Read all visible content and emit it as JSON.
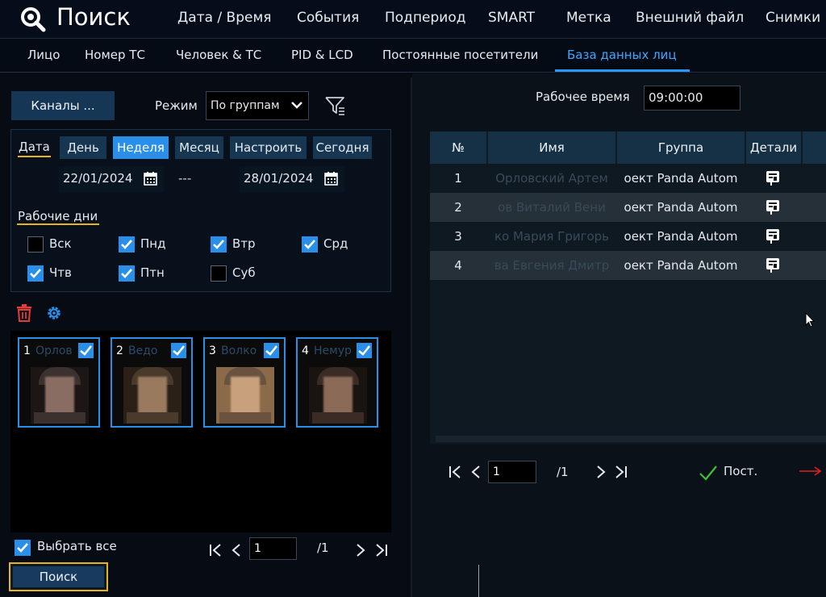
{
  "header": {
    "title": "Поиск",
    "menu": [
      "Дата / Время",
      "События",
      "Подпериод",
      "SMART",
      "Метка",
      "Внешний файл",
      "Снимки"
    ]
  },
  "subtabs": {
    "items": [
      "Лицо",
      "Номер ТС",
      "Человек & ТС",
      "PID & LCD",
      "Постоянные посетители",
      "База данных лиц"
    ],
    "active": "База данных лиц"
  },
  "left": {
    "channels_button": "Каналы ...",
    "mode_label": "Режим",
    "mode_value": "По группам",
    "date_label": "Дата",
    "periods": [
      "День",
      "Неделя",
      "Месяц",
      "Настроить",
      "Сегодня"
    ],
    "active_period": "Неделя",
    "start_date": "22/01/2024",
    "date_separator": "---",
    "end_date": "28/01/2024",
    "workdays_label": "Рабочие дни",
    "days": [
      {
        "label": "Вск",
        "checked": false
      },
      {
        "label": "Пнд",
        "checked": true
      },
      {
        "label": "Втр",
        "checked": true
      },
      {
        "label": "Срд",
        "checked": true
      },
      {
        "label": "Чтв",
        "checked": true
      },
      {
        "label": "Птн",
        "checked": true
      },
      {
        "label": "Суб",
        "checked": false
      }
    ],
    "faces": [
      {
        "num": "1",
        "name": "Орлов",
        "checked": true
      },
      {
        "num": "2",
        "name": "Ведо",
        "checked": true
      },
      {
        "num": "3",
        "name": "Волко",
        "checked": true
      },
      {
        "num": "4",
        "name": "Немур",
        "checked": true
      }
    ],
    "select_all_label": "Выбрать все",
    "page_value": "1",
    "page_total": "/1",
    "search_button": "Поиск"
  },
  "right": {
    "worktime_label": "Рабочее время",
    "worktime_value": "09:00:00",
    "columns": [
      "№",
      "Имя",
      "Группа",
      "Детали"
    ],
    "rows": [
      {
        "num": "1",
        "name": "Орловский Артем",
        "group": "оект Panda Autom"
      },
      {
        "num": "2",
        "name": "ов Виталий Вени",
        "group": "оект Panda Autom"
      },
      {
        "num": "3",
        "name": "ко Мария Григорь",
        "group": "оект Panda Autom"
      },
      {
        "num": "4",
        "name": "ва Евгения Дмитр",
        "group": "оект Panda Autom"
      }
    ],
    "page_value": "1",
    "page_total": "/1",
    "save_label": "Пост."
  },
  "colors": {
    "accent": "#2a8fe8",
    "highlight": "#e8b419",
    "save_check": "#3ac23a",
    "arrow": "#e02020",
    "delete": "#e43b3b"
  }
}
